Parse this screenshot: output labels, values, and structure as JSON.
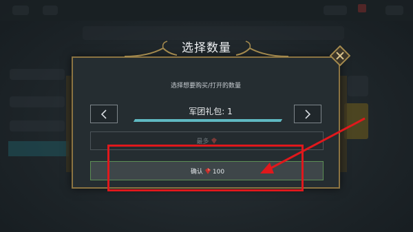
{
  "dialog": {
    "title": "选择数量",
    "subtitle": "选择想要购买/打开的数量",
    "item_label": "军团礼包: 1",
    "quantity_fraction": 1.0,
    "max_label": "最多",
    "confirm_label": "确认",
    "confirm_cost": "100"
  },
  "icons": {
    "left": "chevron-left-icon",
    "right": "chevron-right-icon",
    "close": "close-icon",
    "currency": "red-gem-icon"
  },
  "colors": {
    "frame_gold": "#8c7442",
    "bar_teal": "#5fb9c2",
    "confirm_border": "#5d8f56",
    "annotation_red": "#e0181c",
    "gem_red": "#c4302c"
  }
}
